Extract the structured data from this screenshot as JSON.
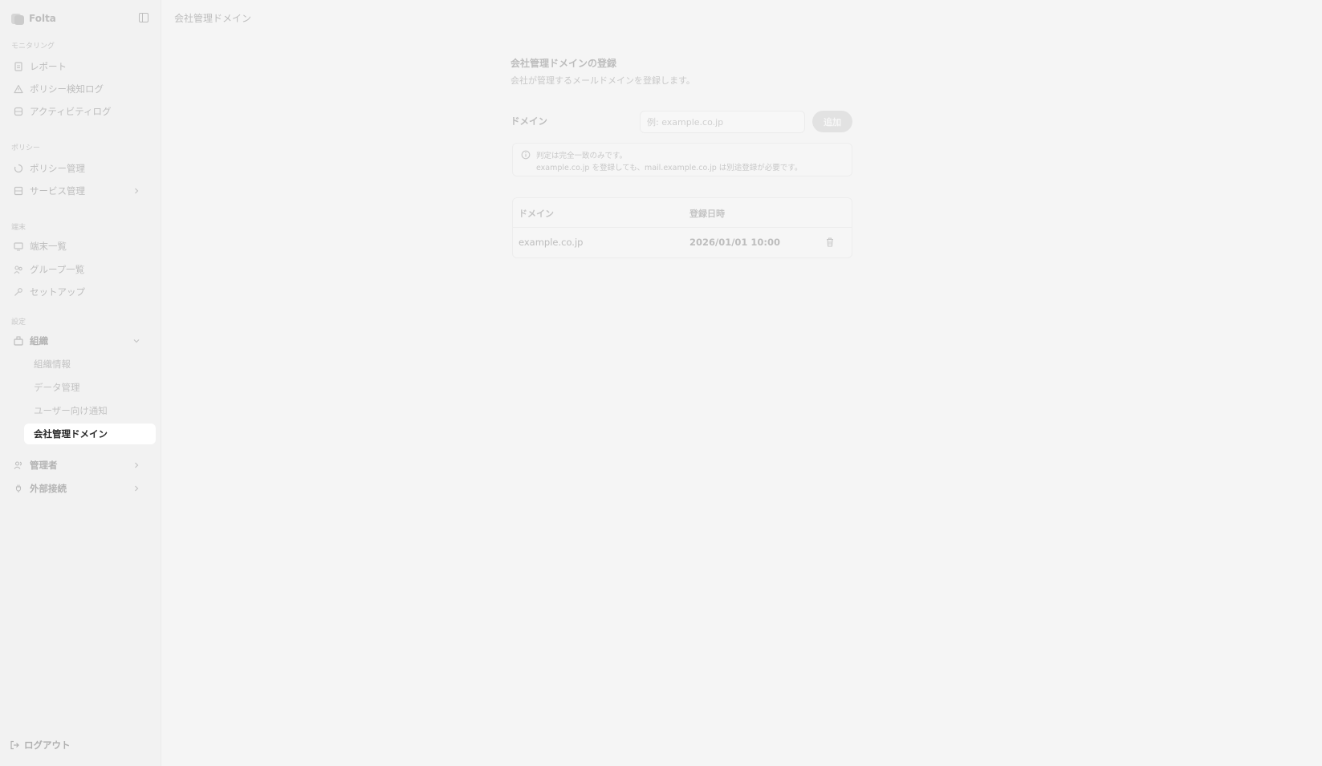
{
  "app": {
    "name": "Folta"
  },
  "header": {
    "title": "会社管理ドメイン"
  },
  "sidebar": {
    "sections": [
      {
        "label": "モニタリング"
      },
      {
        "label": "ポリシー"
      },
      {
        "label": "端末"
      },
      {
        "label": "設定"
      }
    ],
    "items": [
      {
        "label": "レポート",
        "icon": "report-icon"
      },
      {
        "label": "ポリシー検知ログ",
        "icon": "warning-icon"
      },
      {
        "label": "アクティビティログ",
        "icon": "database-icon"
      },
      {
        "label": "ポリシー管理",
        "icon": "policy-icon"
      },
      {
        "label": "サービス管理",
        "icon": "service-icon"
      },
      {
        "label": "端末一覧",
        "icon": "monitor-icon"
      },
      {
        "label": "グループ一覧",
        "icon": "group-icon"
      },
      {
        "label": "セットアップ",
        "icon": "key-icon"
      },
      {
        "label": "組織",
        "icon": "organization-icon"
      },
      {
        "label": "管理者",
        "icon": "users-icon"
      },
      {
        "label": "外部接続",
        "icon": "plug-icon"
      }
    ],
    "sub_items": [
      {
        "label": "組織情報"
      },
      {
        "label": "データ管理"
      },
      {
        "label": "ユーザー向け通知"
      },
      {
        "label": "会社管理ドメイン",
        "active": true
      }
    ],
    "logout_label": "ログアウト"
  },
  "main": {
    "title": "会社管理ドメインの登録",
    "description": "会社が管理するメールドメインを登録します。",
    "field_label": "ドメイン",
    "input_placeholder": "例: example.co.jp",
    "input_value": "",
    "add_button": "追加",
    "info_line1": "判定は完全一致のみです。",
    "info_line2": "example.co.jp を登録しても、mail.example.co.jp は別途登録が必要です。",
    "table": {
      "columns": [
        "ドメイン",
        "登録日時"
      ],
      "rows": [
        {
          "domain": "example.co.jp",
          "registered_at": "2026/01/01 10:00"
        }
      ]
    }
  },
  "colors": {
    "background": "#f5f5f5",
    "sidebar_background": "#f2f2f2",
    "active_item_background": "#ffffff",
    "active_item_text": "#2a2a2a",
    "muted_text": "#bdbdbd"
  }
}
